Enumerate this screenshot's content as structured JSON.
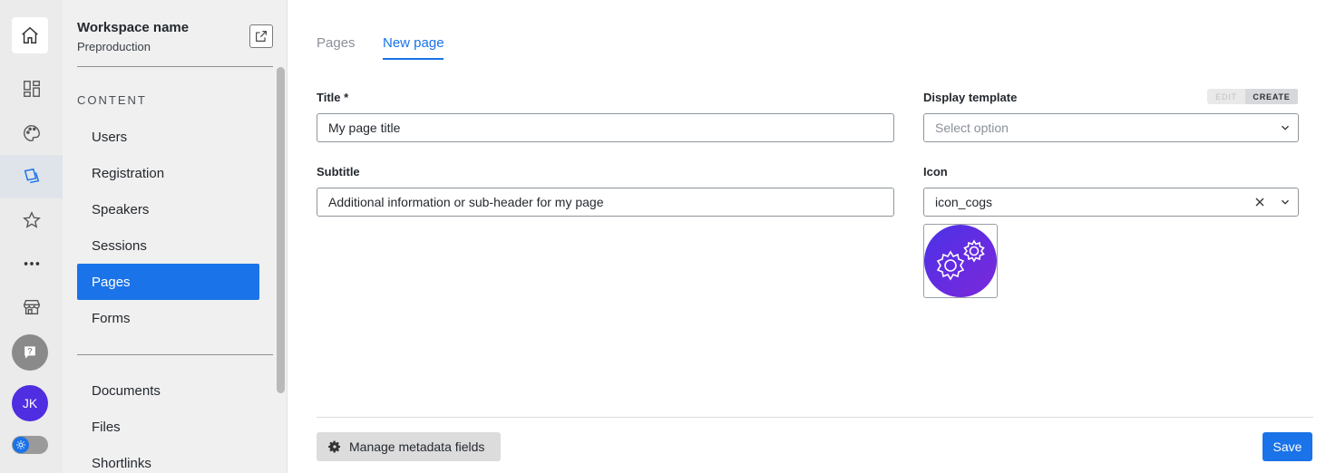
{
  "rail": {
    "items": [
      {
        "icon": "home-icon"
      },
      {
        "icon": "dashboard-icon"
      },
      {
        "icon": "palette-icon"
      },
      {
        "icon": "content-icon",
        "active": true
      },
      {
        "icon": "star-icon"
      },
      {
        "icon": "more-icon"
      },
      {
        "icon": "store-icon"
      },
      {
        "icon": "help-icon"
      }
    ],
    "avatar_initials": "JK",
    "theme_toggle": "light"
  },
  "sidebar": {
    "workspace_name": "Workspace name",
    "environment": "Preproduction",
    "section_label": "CONTENT",
    "items": [
      {
        "label": "Users"
      },
      {
        "label": "Registration"
      },
      {
        "label": "Speakers"
      },
      {
        "label": "Sessions"
      },
      {
        "label": "Pages",
        "active": true
      },
      {
        "label": "Forms"
      }
    ],
    "items_2": [
      {
        "label": "Documents"
      },
      {
        "label": "Files"
      },
      {
        "label": "Shortlinks"
      }
    ]
  },
  "tabs": [
    {
      "label": "Pages",
      "active": false
    },
    {
      "label": "New page",
      "active": true
    }
  ],
  "form": {
    "title_label": "Title *",
    "title_value": "My page title",
    "subtitle_label": "Subtitle",
    "subtitle_value": "Additional information or sub-header for my page",
    "template_label": "Display template",
    "template_placeholder": "Select option",
    "mode_edit": "EDIT",
    "mode_create": "CREATE",
    "icon_label": "Icon",
    "icon_value": "icon_cogs"
  },
  "footer": {
    "metadata_button": "Manage metadata fields",
    "save_button": "Save"
  },
  "colors": {
    "accent": "#1a73e8",
    "avatar": "#4f2de0",
    "icon_preview": "#5b2fe3"
  }
}
